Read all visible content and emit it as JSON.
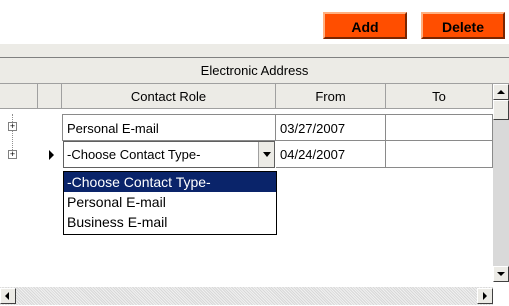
{
  "toolbar": {
    "add_label": "Add",
    "delete_label": "Delete"
  },
  "grid": {
    "title": "Electronic Address",
    "columns": [
      "Contact Role",
      "From",
      "To"
    ],
    "rows": [
      {
        "role": "Personal E-mail",
        "from": "03/27/2007",
        "to": ""
      },
      {
        "role": "-Choose Contact Type-",
        "from": "04/24/2007",
        "to": ""
      }
    ]
  },
  "dropdown": {
    "options": [
      "-Choose Contact Type-",
      "Personal E-mail",
      "Business E-mail"
    ],
    "selected_index": 0
  },
  "colors": {
    "button_bg": "#ff4e00",
    "selection_bg": "#0a246a"
  }
}
